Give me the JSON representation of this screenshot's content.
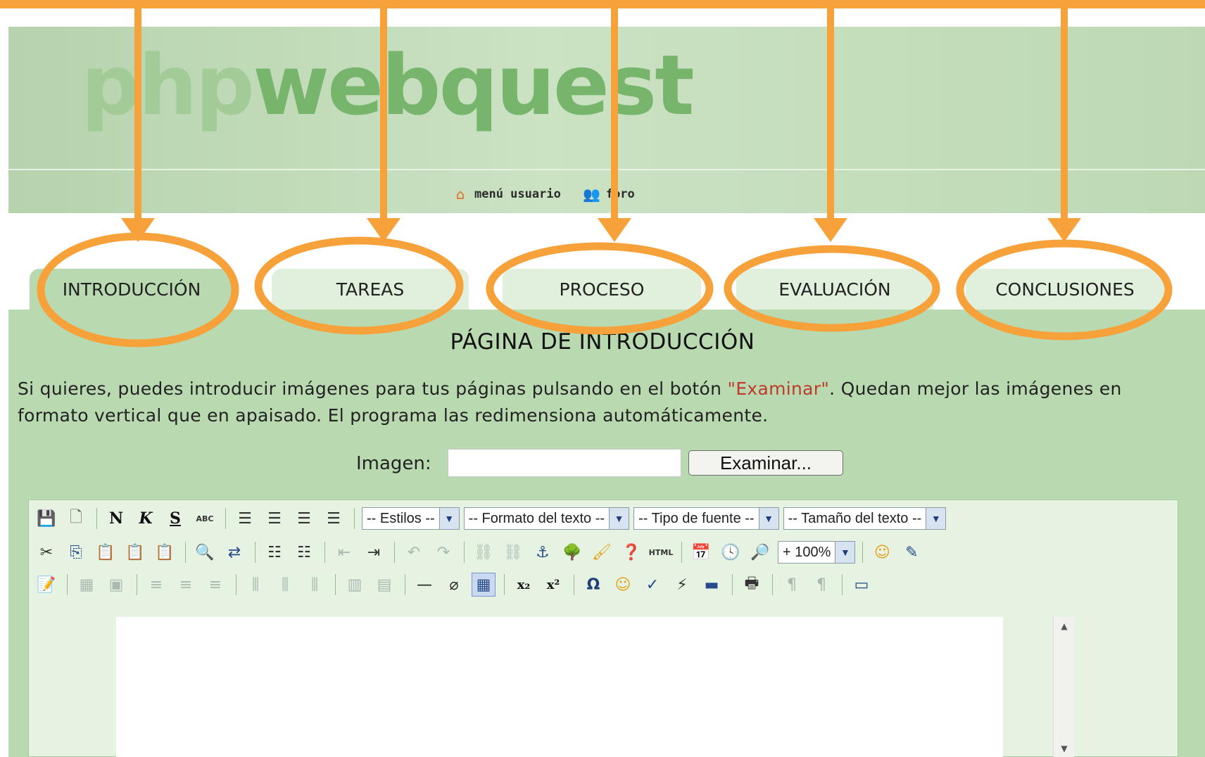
{
  "logo": {
    "part1": "php",
    "part2": "webquest"
  },
  "user_nav": {
    "menu_usuario": {
      "label": "menú usuario",
      "icon": "house-icon"
    },
    "foro": {
      "label": "foro",
      "icon": "users-icon"
    }
  },
  "tabs": [
    {
      "label": "INTRODUCCIÓN",
      "active": true
    },
    {
      "label": "TAREAS",
      "active": false
    },
    {
      "label": "PROCESO",
      "active": false
    },
    {
      "label": "EVALUACIÓN",
      "active": false
    },
    {
      "label": "CONCLUSIONES",
      "active": false
    }
  ],
  "page": {
    "title": "PÁGINA DE INTRODUCCIÓN",
    "desc_before": "Si quieres, puedes introducir imágenes para tus páginas pulsando en el botón ",
    "desc_highlight": "\"Examinar\"",
    "desc_after": ". Quedan mejor las imágenes en formato vertical que en apaisado. El programa las redimensiona automáticamente.",
    "image_label": "Imagen:",
    "image_value": "",
    "browse_label": "Examinar..."
  },
  "editor": {
    "styles_select": "-- Estilos --",
    "format_select": "-- Formato del texto --",
    "font_select": "-- Tipo de fuente --",
    "size_select": "-- Tamaño del texto --",
    "zoom_select": "+ 100%",
    "bold_label": "N",
    "italic_label": "K",
    "underline_label": "S",
    "abc_label": "ABC",
    "html_label": "HTML",
    "sub_label": "x₂",
    "sup_label": "x²",
    "omega_label": "Ω"
  },
  "colors": {
    "accent": "#f7a13b",
    "header": "#c3ddb9",
    "panel": "#b9dab0",
    "highlight": "#c0392b"
  }
}
